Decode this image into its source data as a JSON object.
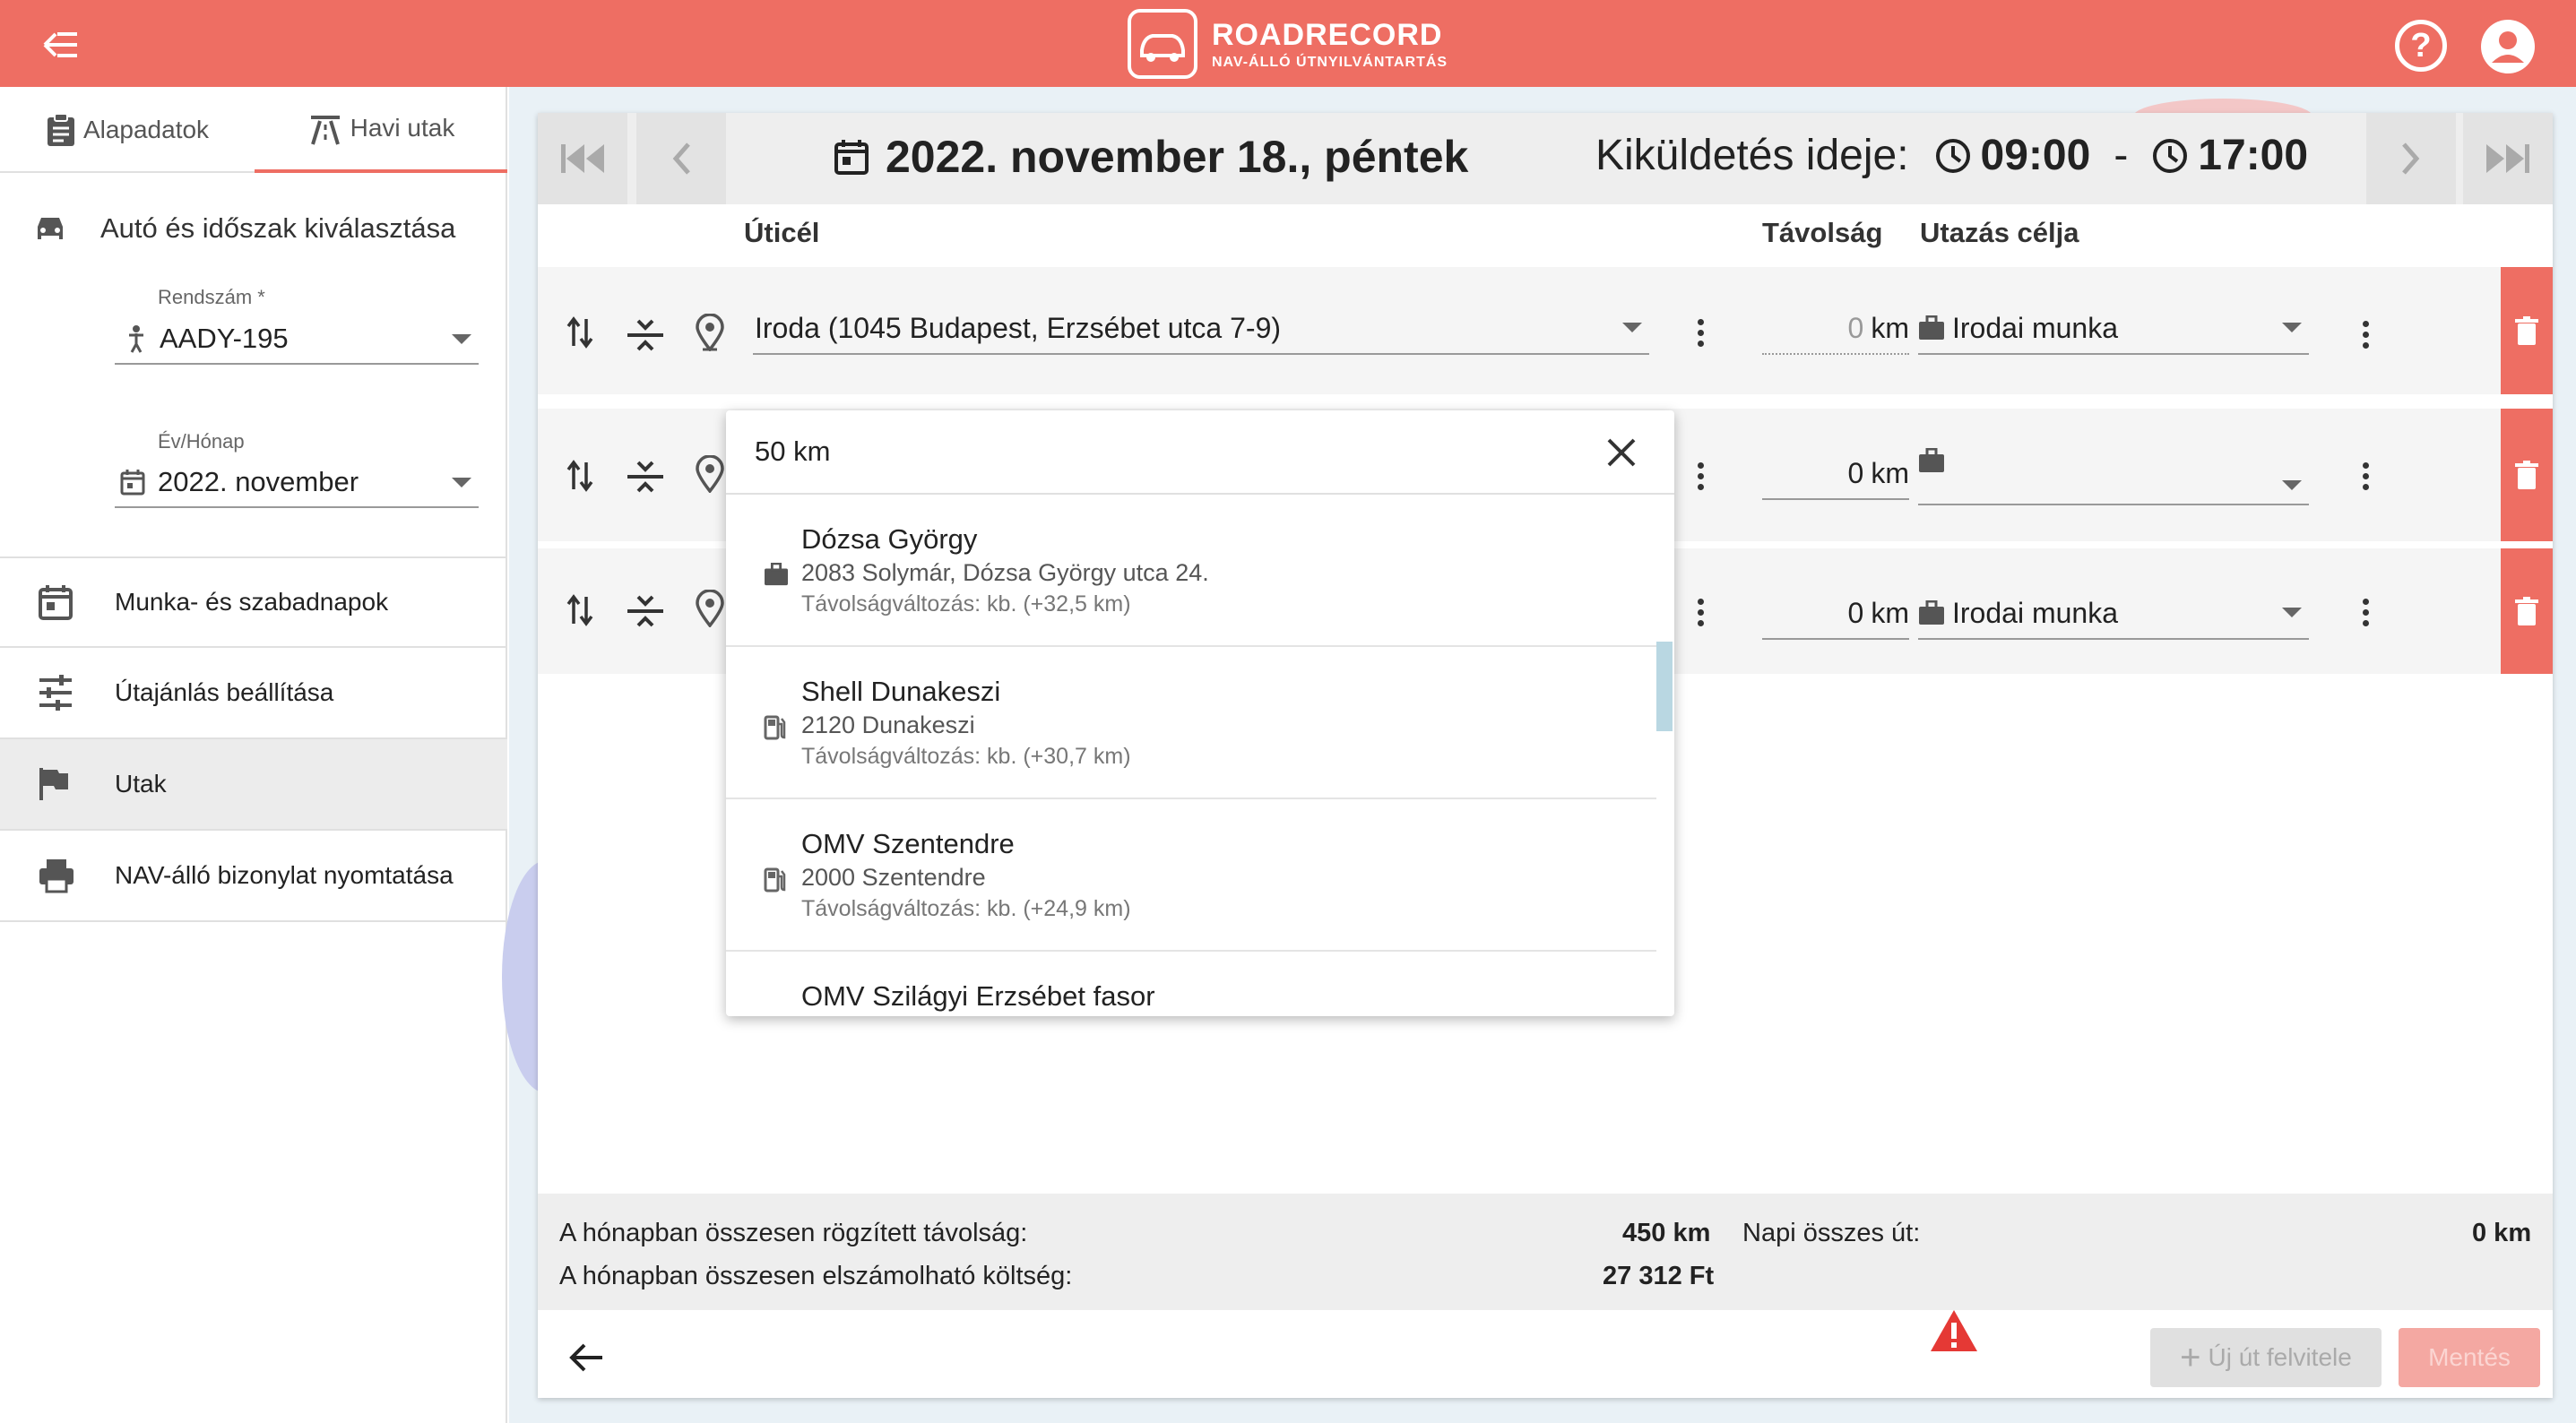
{
  "header": {
    "brand_name": "ROADRECORD",
    "brand_sub": "NAV-ÁLLÓ ÚTNYILVÁNTARTÁS",
    "help_label": "?",
    "bg_color": "#ee6e63"
  },
  "sidebar": {
    "tabs": [
      {
        "label": "Alapadatok",
        "icon": "clipboard-icon"
      },
      {
        "label": "Havi utak",
        "icon": "road-icon",
        "active": true
      }
    ],
    "section_title": "Autó és időszak kiválasztása",
    "plate_label": "Rendszám *",
    "plate_value": "AADY-195",
    "month_label": "Év/Hónap",
    "month_value": "2022. november",
    "menu": [
      {
        "label": "Munka- és szabadnapok",
        "icon": "calendar-icon"
      },
      {
        "label": "Útajánlás beállítása",
        "icon": "sliders-icon"
      },
      {
        "label": "Utak",
        "icon": "flag-icon",
        "active": true
      },
      {
        "label": "NAV-álló bizonylat nyomtatása",
        "icon": "printer-icon"
      }
    ]
  },
  "main": {
    "date_title": "2022. november 18., péntek",
    "kikuldes_label": "Kiküldetés ideje:",
    "time_start": "09:00",
    "time_sep": "-",
    "time_end": "17:00",
    "columns": {
      "dest": "Úticél",
      "dist": "Távolság",
      "purpose": "Utazás célja"
    },
    "rows": [
      {
        "dest": "Iroda (1045 Budapest, Erzsébet utca 7-9)",
        "dist_num": "0",
        "dist_unit": "km",
        "purpose": "Irodai munka"
      },
      {
        "dest": "",
        "dist_num": "0",
        "dist_unit": "km",
        "purpose": ""
      },
      {
        "dest": "",
        "dist_num": "0",
        "dist_unit": "km",
        "purpose": "Irodai munka"
      }
    ]
  },
  "dropdown": {
    "search_value": "50 km",
    "items": [
      {
        "name": "Dózsa György",
        "addr": "2083 Solymár, Dózsa György utca 24.",
        "change": "Távolságváltozás: kb. (+32,5 km)",
        "icon": "briefcase-icon"
      },
      {
        "name": "Shell Dunakeszi",
        "addr": "2120 Dunakeszi",
        "change": "Távolságváltozás: kb. (+30,7 km)",
        "icon": "fuel-icon"
      },
      {
        "name": "OMV Szentendre",
        "addr": "2000 Szentendre",
        "change": "Távolságváltozás: kb. (+24,9 km)",
        "icon": "fuel-icon"
      },
      {
        "name": "OMV Szilágyi Erzsébet fasor",
        "addr": "",
        "change": "",
        "icon": "fuel-icon"
      }
    ]
  },
  "summary": {
    "total_dist_label": "A hónapban összesen rögzített távolság:",
    "total_dist_value": "450 km",
    "total_cost_label": "A hónapban összesen elszámolható költség:",
    "total_cost_value": "27 312 Ft",
    "daily_label": "Napi összes út:",
    "daily_value": "0 km"
  },
  "footer": {
    "new_trip": "Új út felvitele",
    "save": "Mentés"
  }
}
